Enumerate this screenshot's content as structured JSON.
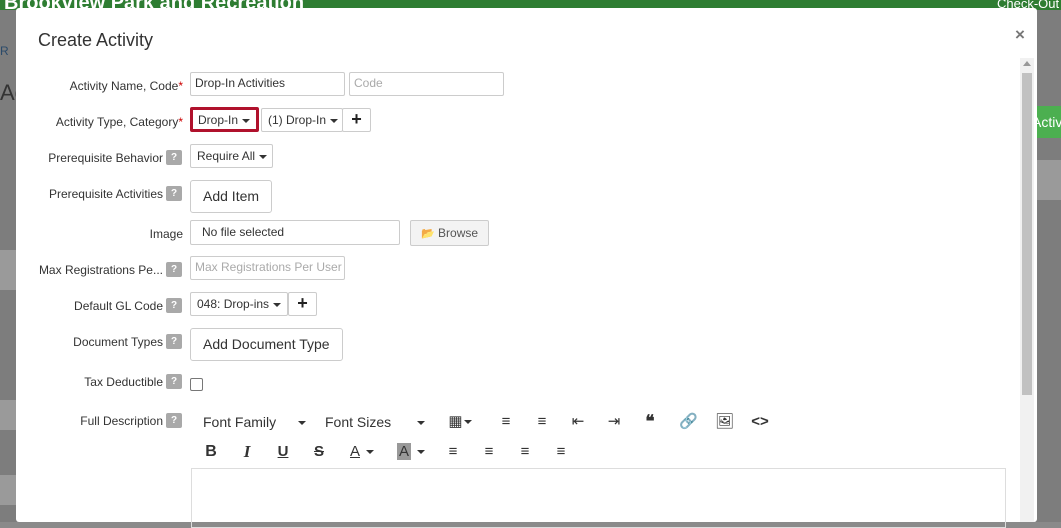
{
  "background": {
    "app_title": "Brookview Park and Recreation",
    "checkout_label": "Check-Out",
    "fragment_r": "R",
    "fragment_activ": "Activ",
    "green_button_label": "Activi"
  },
  "modal": {
    "title": "Create Activity",
    "close_label": "×"
  },
  "form": {
    "activity_name_label": "Activity Name, Code",
    "activity_name_value": "Drop-In Activities",
    "code_placeholder": "Code",
    "activity_type_label": "Activity Type, Category",
    "activity_type_value": "Drop-In",
    "category_value": "(1) Drop-In",
    "prereq_behavior_label": "Prerequisite Behavior",
    "prereq_behavior_value": "Require All",
    "prereq_activities_label": "Prerequisite Activities",
    "add_item_label": "Add Item",
    "image_label": "Image",
    "image_value": "No file selected",
    "browse_label": "Browse",
    "max_reg_label": "Max Registrations Pe...",
    "max_reg_placeholder": "Max Registrations Per User",
    "gl_code_label": "Default GL Code",
    "gl_code_value": "048: Drop-ins",
    "doc_types_label": "Document Types",
    "add_doc_type_label": "Add Document Type",
    "tax_deductible_label": "Tax Deductible",
    "full_desc_label": "Full Description",
    "help_glyph": "?",
    "required_mark": "*"
  },
  "editor": {
    "font_family_label": "Font Family",
    "font_sizes_label": "Font Sizes"
  },
  "colors": {
    "highlight": "#b0112c",
    "brand_green": "#2e7d32",
    "required": "#cc0000"
  }
}
